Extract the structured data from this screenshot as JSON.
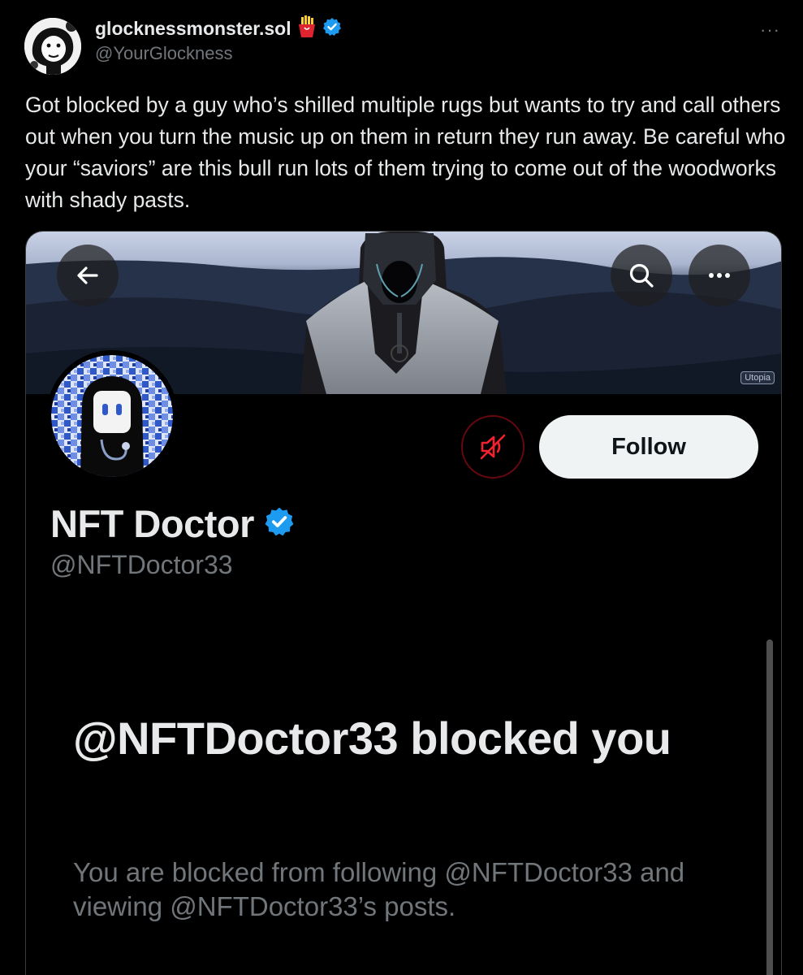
{
  "tweet": {
    "author_name": "glocknessmonster.sol",
    "author_handle": "@YourGlockness",
    "name_emoji": "fries-emoji",
    "verified_icon": "verified-badge-icon",
    "more_icon": "more-horizontal-icon",
    "more_label": "···",
    "text": "Got blocked by a guy who’s shilled multiple rugs but wants to try and call others out when you turn the music up on them in return they run away. Be careful who your “saviors” are this bull run lots of them trying to come out of the woodworks with shady pasts."
  },
  "screenshot": {
    "banner_watermark": "Utopia",
    "profile": {
      "name": "NFT Doctor",
      "handle": "@NFTDoctor33",
      "follow_label": "Follow"
    },
    "blocked": {
      "title": "@NFTDoctor33 blocked you",
      "subtitle": "You are blocked from following @NFTDoctor33 and viewing @NFTDoctor33’s posts."
    }
  },
  "colors": {
    "background": "#000000",
    "text_primary": "#e7e9ea",
    "text_secondary": "#71767b",
    "verified_blue": "#1d9bf0",
    "mute_red": "#f4212e",
    "follow_bg": "#eff3f4"
  }
}
